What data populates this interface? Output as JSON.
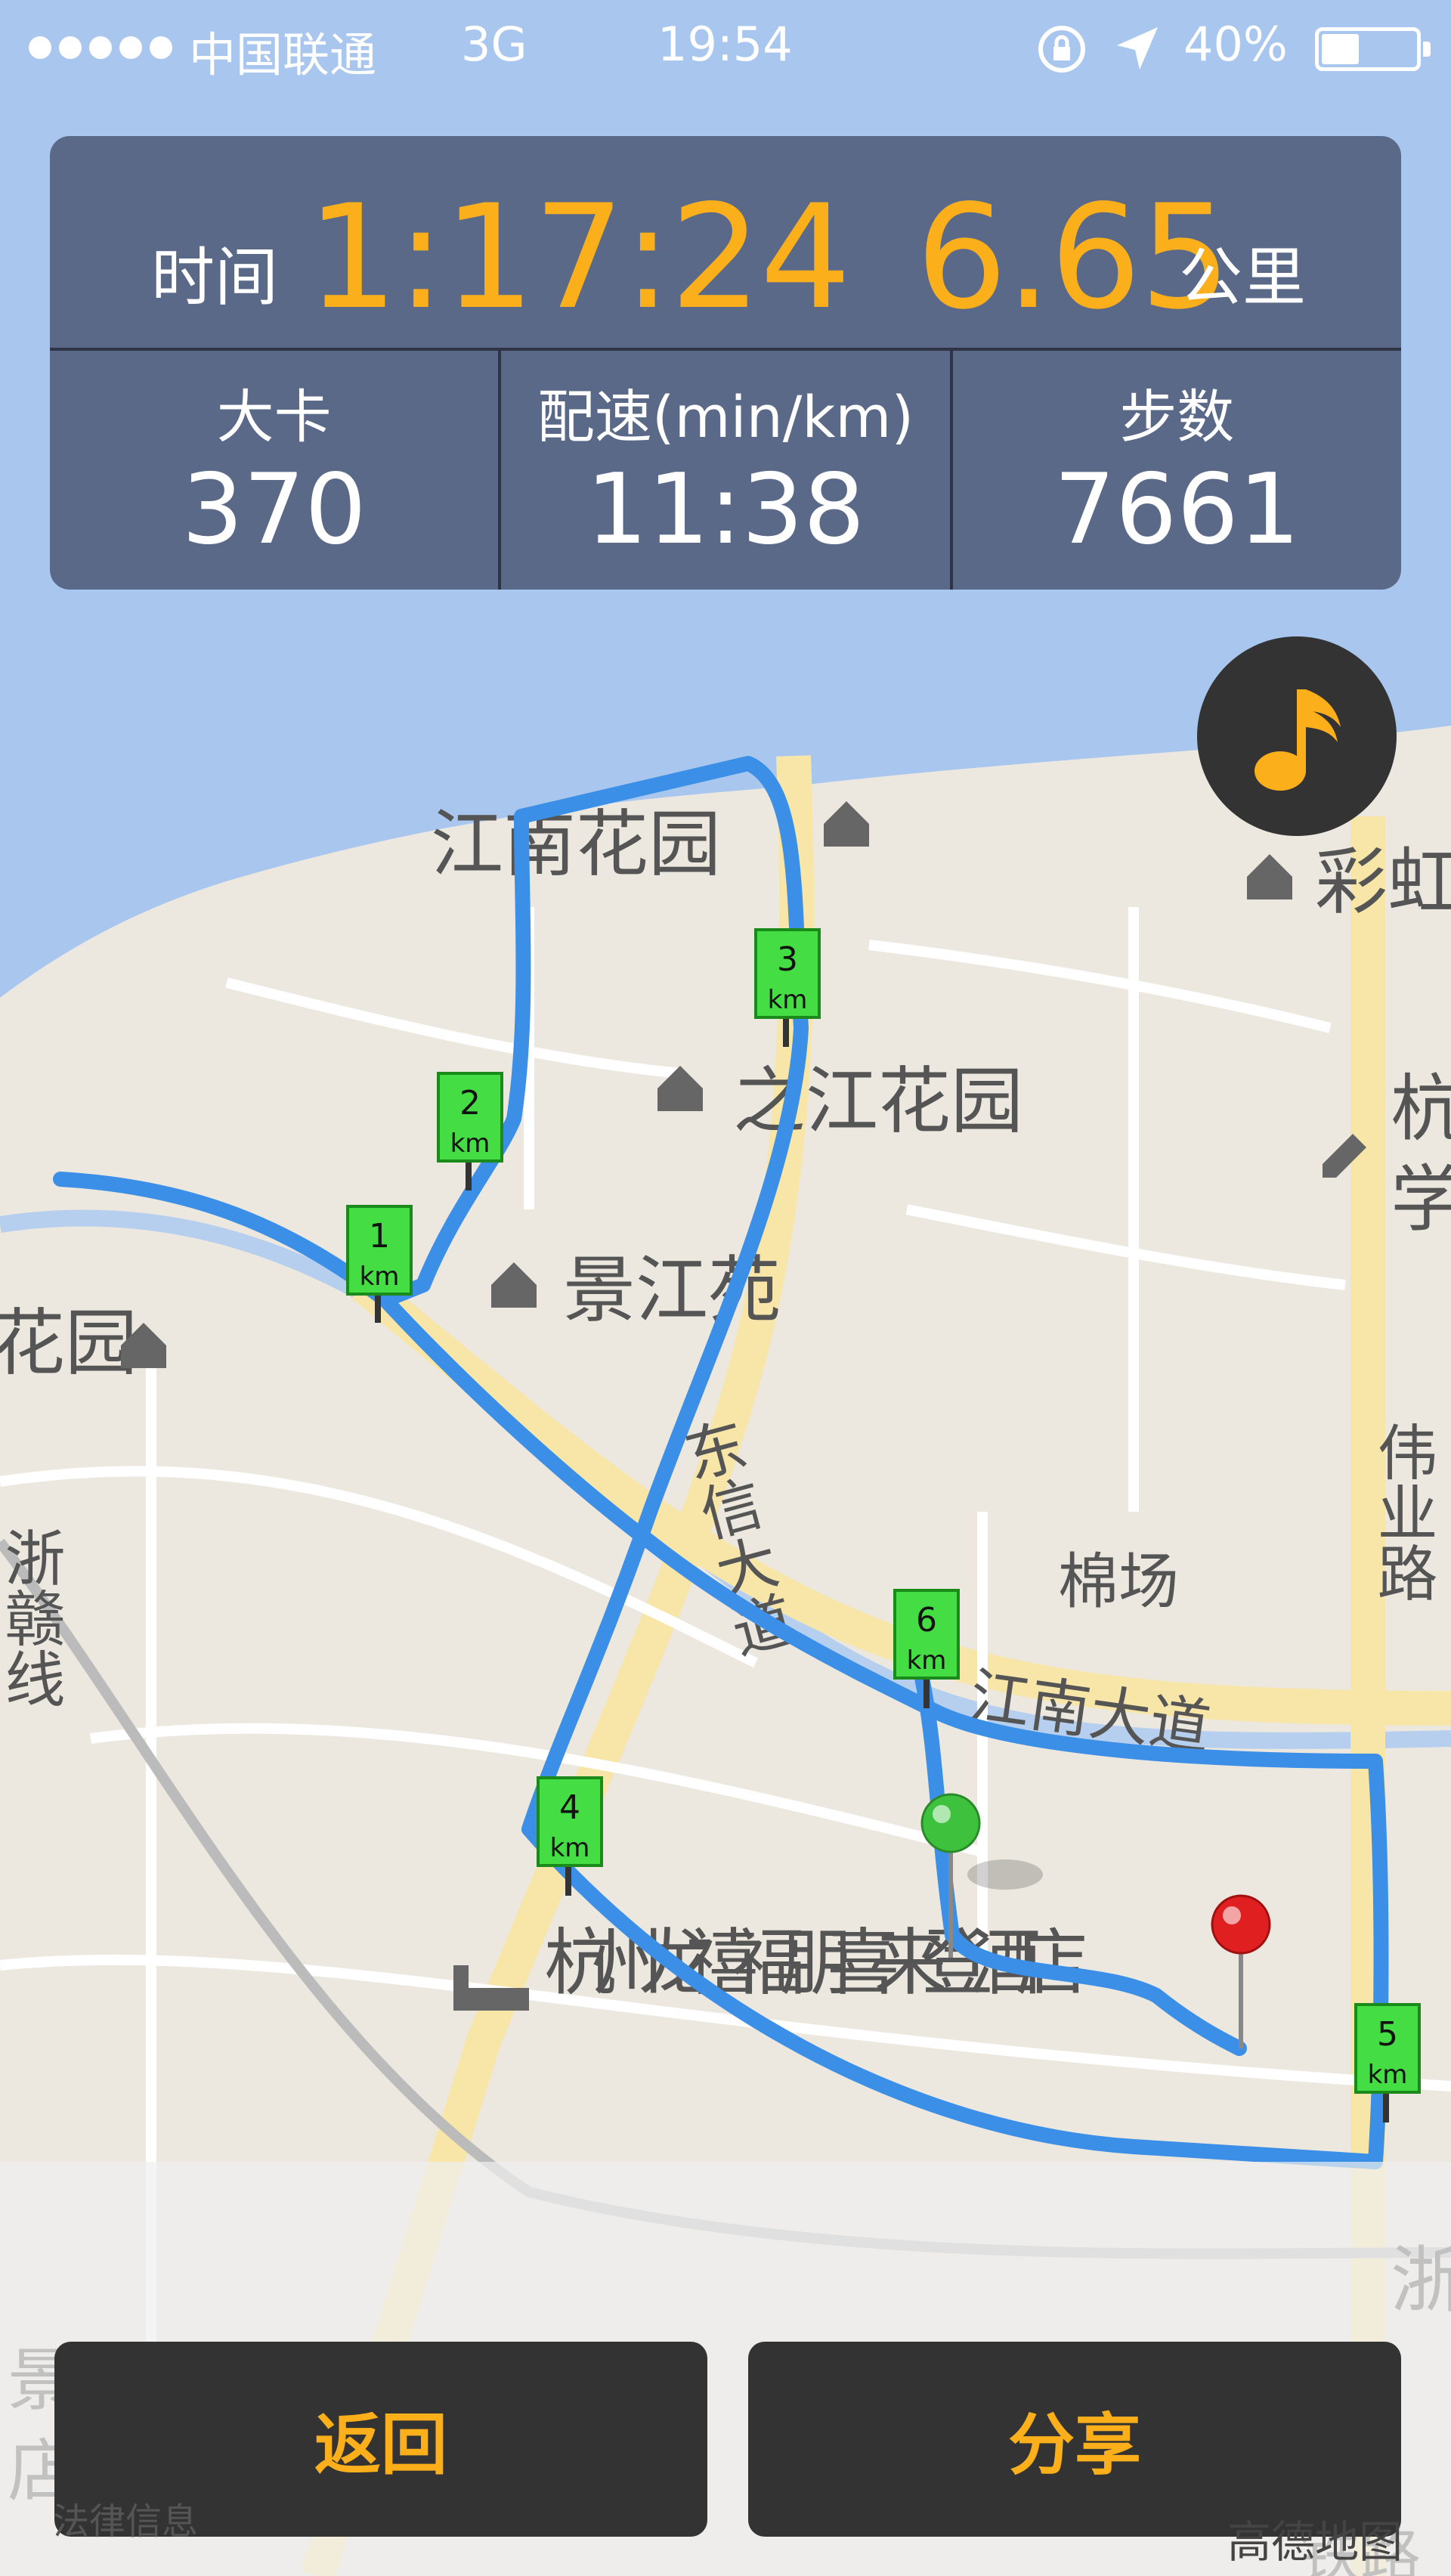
{
  "status_bar": {
    "carrier": "中国联通",
    "network": "3G",
    "time": "19:54",
    "battery_percent": "40%",
    "battery_level": 0.4,
    "icons": [
      "signal-dots-icon",
      "rotation-lock-icon",
      "location-arrow-icon",
      "battery-icon"
    ]
  },
  "summary": {
    "time_label": "时间",
    "time_value": "1:17:24",
    "distance_value": "6.65",
    "distance_unit": "公里"
  },
  "stats": [
    {
      "label": "大卡",
      "value": "370"
    },
    {
      "label": "配速(min/km)",
      "value": "11:38"
    },
    {
      "label": "步数",
      "value": "7661"
    }
  ],
  "music_button": {
    "icon": "music-note-icon"
  },
  "map": {
    "place_labels": [
      "江南花园",
      "之江花园",
      "景江苑",
      "花园",
      "彩虹",
      "杭",
      "学",
      "棉场",
      "伟业路",
      "浙赣线",
      "东信大道",
      "江南大道",
      "杭州龙禧福朋喜来登酒店",
      "浙",
      "景",
      "店",
      "铁路"
    ],
    "km_markers": [
      {
        "num": "1",
        "unit": "km"
      },
      {
        "num": "2",
        "unit": "km"
      },
      {
        "num": "3",
        "unit": "km"
      },
      {
        "num": "4",
        "unit": "km"
      },
      {
        "num": "5",
        "unit": "km"
      },
      {
        "num": "6",
        "unit": "km"
      }
    ],
    "start_pin_color": "#3ec23e",
    "end_pin_color": "#e02020",
    "route_color": "#3b8fe6"
  },
  "buttons": {
    "back": "返回",
    "share": "分享"
  },
  "footer": {
    "legal": "法律信息",
    "map_provider": "高德地图"
  },
  "colors": {
    "accent": "#fbb01b",
    "panel": "#556180",
    "water": "#a9c7ee"
  }
}
